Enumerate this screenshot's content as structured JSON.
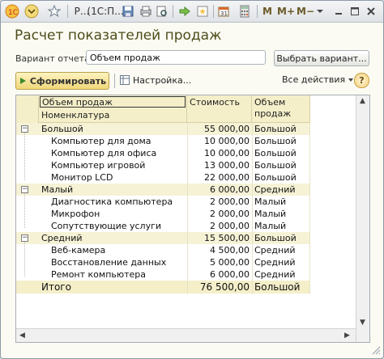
{
  "toolbar": {
    "title_short": "Р...",
    "app_short": "(1С:П...",
    "m": "M",
    "mplus": "M+",
    "mminus": "M−"
  },
  "window": {
    "title": "Расчет показателей продаж"
  },
  "settings": {
    "variant_label": "Вариант отчета:",
    "variant_value": "Объем продаж",
    "select_variant_button": "Выбрать вариант...",
    "form_button": "Сформировать",
    "settings_button": "Настройка...",
    "all_actions": "Все действия",
    "help": "?"
  },
  "table": {
    "header": {
      "volume_group": "Объем продаж",
      "nomenclature": "Номенклатура",
      "cost": "Стоимость",
      "volume": "Объем продаж"
    },
    "groups": [
      {
        "name": "Большой",
        "cost": "55 000,00",
        "volume": "Большой",
        "items": [
          {
            "name": "Компьютер для дома",
            "cost": "10 000,00",
            "volume": "Большой"
          },
          {
            "name": "Компьютер для офиса",
            "cost": "10 000,00",
            "volume": "Большой"
          },
          {
            "name": "Компьютер игровой",
            "cost": "13 000,00",
            "volume": "Большой"
          },
          {
            "name": "Монитор LCD",
            "cost": "22 000,00",
            "volume": "Большой"
          }
        ]
      },
      {
        "name": "Малый",
        "cost": "6 000,00",
        "volume": "Средний",
        "items": [
          {
            "name": "Диагностика компьютера",
            "cost": "2 000,00",
            "volume": "Малый"
          },
          {
            "name": "Микрофон",
            "cost": "2 000,00",
            "volume": "Малый"
          },
          {
            "name": "Сопутствующие услуги",
            "cost": "2 000,00",
            "volume": "Малый"
          }
        ]
      },
      {
        "name": "Средний",
        "cost": "15 500,00",
        "volume": "Большой",
        "items": [
          {
            "name": "Веб-камера",
            "cost": "4 500,00",
            "volume": "Средний"
          },
          {
            "name": "Восстановление данных",
            "cost": "5 000,00",
            "volume": "Средний"
          },
          {
            "name": "Ремонт компьютера",
            "cost": "6 000,00",
            "volume": "Средний"
          }
        ]
      }
    ],
    "total": {
      "name": "Итого",
      "cost": "76 500,00",
      "volume": "Большой"
    }
  },
  "colors": {
    "title": "#4e4d1b",
    "header_bg": "#f4efc9",
    "group_bg": "#f6f2d6",
    "form_button_bg": "#f1d77a"
  }
}
